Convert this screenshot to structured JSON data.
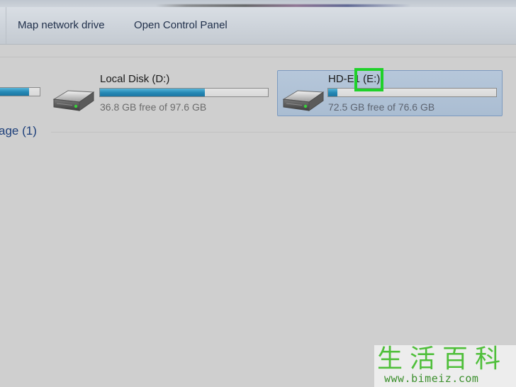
{
  "toolbar": {
    "map_network_drive": "Map network drive",
    "open_control_panel": "Open Control Panel"
  },
  "drives": {
    "c": {
      "used_fraction": 0.75
    },
    "d": {
      "name": "Local Disk (D:)",
      "free_text": "36.8 GB free of 97.6 GB",
      "used_fraction": 0.623
    },
    "e": {
      "name": "HD-E1 (E:)",
      "free_text": "72.5 GB free of 76.6 GB",
      "used_fraction": 0.054
    }
  },
  "group": {
    "header": "age (1)"
  },
  "watermark": {
    "chars": "生活百科",
    "url": "www.bimeiz.com"
  },
  "colors": {
    "bar_fill": "#2689b6",
    "selection_bg": "#b6c7da",
    "highlight": "#1fd12a",
    "group_header": "#1d3f7a"
  },
  "icons": {
    "drive": "hard-drive-icon"
  }
}
